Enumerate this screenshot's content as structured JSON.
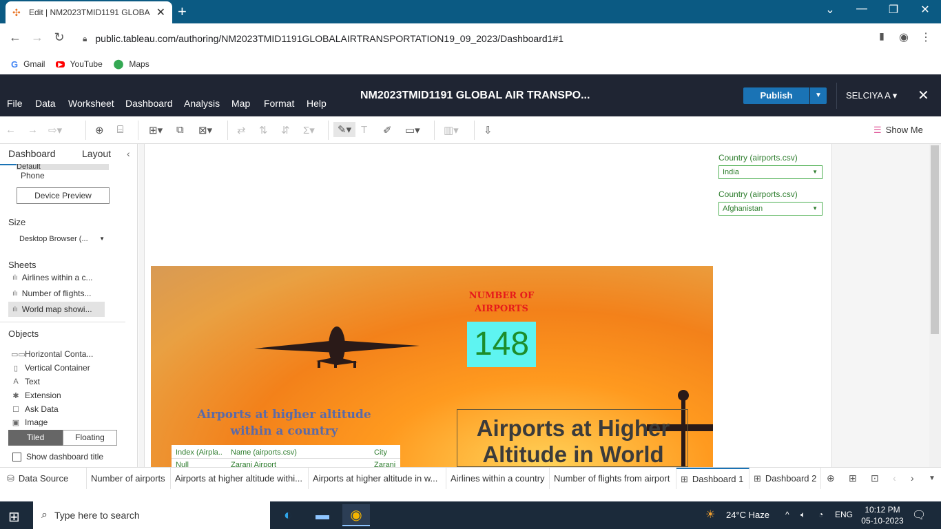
{
  "browser": {
    "tab_title": "Edit | NM2023TMID1191 GLOBA",
    "url": "public.tableau.com/authoring/NM2023TMID1191GLOBALAIRTRANSPORTATION19_09_2023/Dashboard1#1",
    "bookmarks": [
      {
        "label": "Gmail",
        "icon": "gmail-icon"
      },
      {
        "label": "YouTube",
        "icon": "youtube-icon"
      },
      {
        "label": "Maps",
        "icon": "maps-icon"
      }
    ]
  },
  "tableau": {
    "menus": [
      "File",
      "Data",
      "Worksheet",
      "Dashboard",
      "Analysis",
      "Map",
      "Format",
      "Help"
    ],
    "workbook_title": "NM2023TMID1191 GLOBAL AIR TRANSPO...",
    "publish_label": "Publish",
    "user": "SELCIYA A",
    "show_me": "Show Me"
  },
  "left_panel": {
    "tab_dashboard": "Dashboard",
    "tab_layout": "Layout",
    "device_default": "Default",
    "device_phone": "Phone",
    "device_preview": "Device Preview",
    "size_heading": "Size",
    "size_value": "Desktop Browser (...",
    "sheets_heading": "Sheets",
    "sheets": [
      "Airlines within a c...",
      "Number of flights...",
      "World map showi..."
    ],
    "objects_heading": "Objects",
    "objects": [
      {
        "label": "Horizontal Conta...",
        "icon": "horizontal-container-icon"
      },
      {
        "label": "Vertical Container",
        "icon": "vertical-container-icon"
      },
      {
        "label": "Text",
        "icon": "text-icon"
      },
      {
        "label": "Extension",
        "icon": "extension-icon"
      },
      {
        "label": "Ask Data",
        "icon": "ask-data-icon"
      },
      {
        "label": "Image",
        "icon": "image-icon"
      }
    ],
    "tiled": "Tiled",
    "floating": "Floating",
    "show_title": "Show dashboard title"
  },
  "filters": [
    {
      "label": "Country (airports.csv)",
      "value": "India"
    },
    {
      "label": "Country (airports.csv)",
      "value": "Afghanistan"
    }
  ],
  "dashboard": {
    "num_airports_label_1": "NUMBER OF",
    "num_airports_label_2": "AIRPORTS",
    "num_airports_value": "148",
    "left_heading_1": "Airports at higher altitude",
    "left_heading_2": "within a country",
    "right_title_1": "Airports at Higher",
    "right_title_2": "Altitude in World",
    "table_headers": [
      "Index (Airpla..",
      "Name (airports.csv)",
      "City"
    ],
    "table_first_row": [
      "Null",
      "Zaranj Airport",
      "Zaranj"
    ]
  },
  "sheet_tabs": {
    "data_source": "Data Source",
    "tabs": [
      "Number of airports",
      "Airports at higher altitude withi...",
      "Airports at higher altitude in w...",
      "Airlines within a country",
      "Number of flights from airport",
      "Dashboard 1",
      "Dashboard 2"
    ],
    "active": "Dashboard 1"
  },
  "taskbar": {
    "search_placeholder": "Type here to search",
    "weather": "24°C  Haze",
    "language": "ENG",
    "time": "10:12 PM",
    "date": "05-10-2023"
  }
}
